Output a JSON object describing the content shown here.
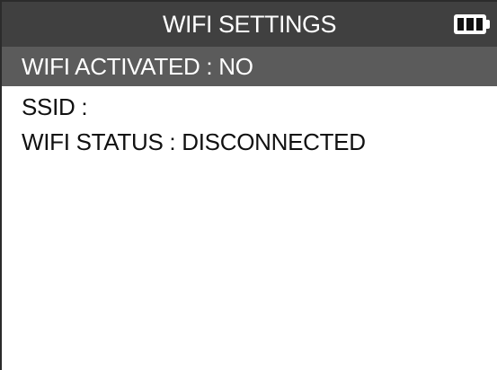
{
  "header": {
    "title": "WIFI SETTINGS",
    "battery_icon": "battery-full-icon",
    "battery_level": 1.0
  },
  "menu": {
    "items": [
      {
        "label": "WIFI ACTIVATED : NO",
        "selected": true
      },
      {
        "label": "SSID :",
        "selected": false
      },
      {
        "label": "WIFI STATUS : DISCONNECTED",
        "selected": false
      }
    ]
  },
  "colors": {
    "title_bar": "#404040",
    "selected_row": "#5b5b5b",
    "background": "#ffffff",
    "text": "#111111"
  }
}
